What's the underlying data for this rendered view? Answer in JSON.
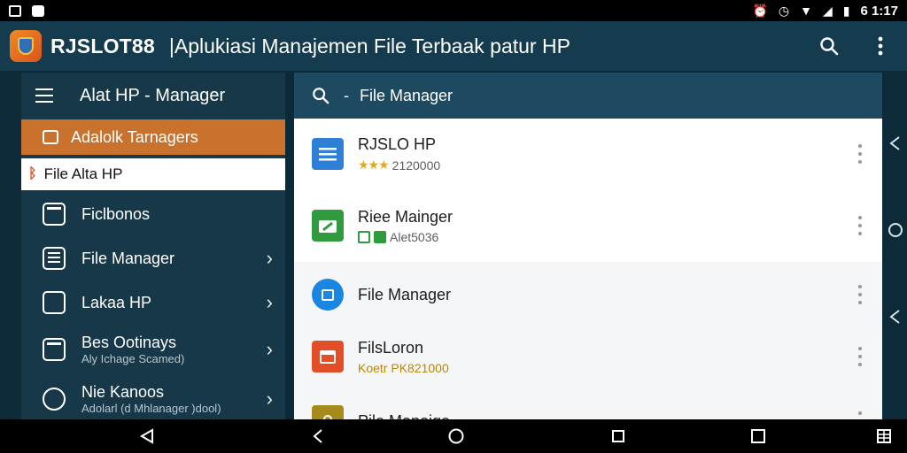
{
  "status_bar": {
    "time": "6 1:17",
    "icons": [
      "notification-icon",
      "android-icon",
      "alarm-icon",
      "clock-icon",
      "wifi-icon",
      "signal-icon",
      "battery-icon"
    ]
  },
  "app_bar": {
    "app_name": "RJSLOT88",
    "title": "|Aplukiasi Manajemen File Terbaak patur HP",
    "actions": [
      "search-icon",
      "more-vert-icon"
    ]
  },
  "drawer": {
    "title": "Alat HP - Manager",
    "items": [
      {
        "label": "Adalolk Tarnagers",
        "icon": "folder-icon",
        "state": "active"
      },
      {
        "label": "File Alta HP",
        "icon": "link-icon",
        "state": "selected"
      },
      {
        "label": "Ficlbonos",
        "icon": "document-icon"
      },
      {
        "label": "File Manager",
        "icon": "list-icon",
        "chevron": true
      },
      {
        "label": "Lakaa HP",
        "icon": "terminal-icon",
        "chevron": true
      },
      {
        "label": "Bes Ootinays",
        "sublabel": "Aly Ichage Scamed)",
        "icon": "file-check-icon",
        "chevron": true
      },
      {
        "label": "Nie Kanoos",
        "sublabel": "Adolarl (d Mhlanager )dool)",
        "icon": "settings-icon",
        "chevron": true
      }
    ]
  },
  "panel": {
    "header_title": "File Manager",
    "files": [
      {
        "name": "RJSLO HP",
        "meta": "2120000",
        "rating_stars": 3,
        "icon_color": "#2f7fd6"
      },
      {
        "name": "Riee Mainger",
        "meta": "Alet5036",
        "icon_color": "#2f9a3e"
      },
      {
        "name": "File Manager",
        "meta": "",
        "icon_color": "#1a86e0"
      },
      {
        "name": "FilsLoron",
        "meta": "Koetr PK821000",
        "icon_color": "#e24e26"
      },
      {
        "name": "Pile Manoige.",
        "meta": "",
        "icon_color": "#a58b1c"
      }
    ]
  },
  "colors": {
    "app_bar": "#143b4e",
    "drawer_bg": "#173848",
    "active_item": "#c9722e",
    "panel_header": "#1d4a60"
  }
}
